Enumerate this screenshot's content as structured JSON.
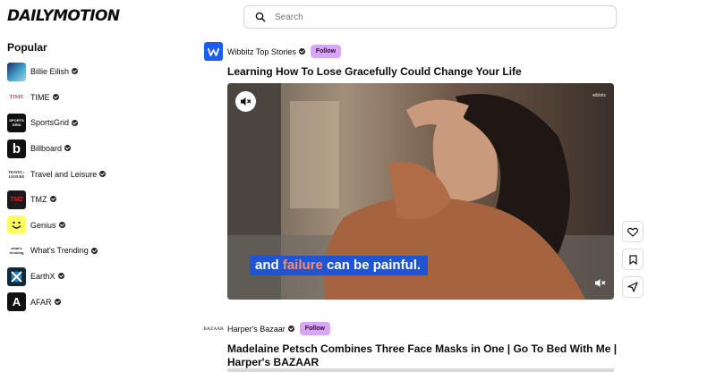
{
  "app": {
    "logo_text": "DAILYMOTION"
  },
  "search": {
    "placeholder": "Search"
  },
  "sidebar": {
    "heading": "Popular",
    "items": [
      {
        "label": "Billie Eilish",
        "icon": "billie-eilish-avatar"
      },
      {
        "label": "TIME",
        "icon": "time-logo",
        "logo_text": "TIME"
      },
      {
        "label": "SportsGrid",
        "icon": "sportsgrid-logo",
        "logo_text": "SPORTS GRID"
      },
      {
        "label": "Billboard",
        "icon": "billboard-logo",
        "logo_text": "b"
      },
      {
        "label": "Travel and Leisure",
        "icon": "travel-leisure-logo",
        "logo_text": "TRAVEL+ LEISURE"
      },
      {
        "label": "TMZ",
        "icon": "tmz-logo",
        "logo_text": "TMZ"
      },
      {
        "label": "Genius",
        "icon": "genius-logo"
      },
      {
        "label": "What's Trending",
        "icon": "whats-trending-logo",
        "logo_text": "what's trending"
      },
      {
        "label": "EarthX",
        "icon": "earthx-logo"
      },
      {
        "label": "AFAR",
        "icon": "afar-logo",
        "logo_text": "A"
      }
    ]
  },
  "feed": [
    {
      "channel": "Wibbitz Top Stories",
      "follow_label": "Follow",
      "title": "Learning How To Lose Gracefully Could Change Your Life",
      "watermark": "wibbitz",
      "caption_pre": "and ",
      "caption_hl": "failure",
      "caption_post": " can be painful."
    },
    {
      "channel": "Harper's Bazaar",
      "channel_logo_text": "BAZAAR",
      "follow_label": "Follow",
      "title": "Madelaine Petsch Combines Three Face Masks in One | Go To Bed With Me | Harper's BAZAAR"
    }
  ],
  "actions": [
    "like-icon",
    "bookmark-icon",
    "share-icon"
  ],
  "colors": {
    "follow": "#d9a6f7",
    "caption_bg": "#1f55d2",
    "caption_highlight": "#ff8e68",
    "wibbitz_blue": "#1d5cf2"
  }
}
